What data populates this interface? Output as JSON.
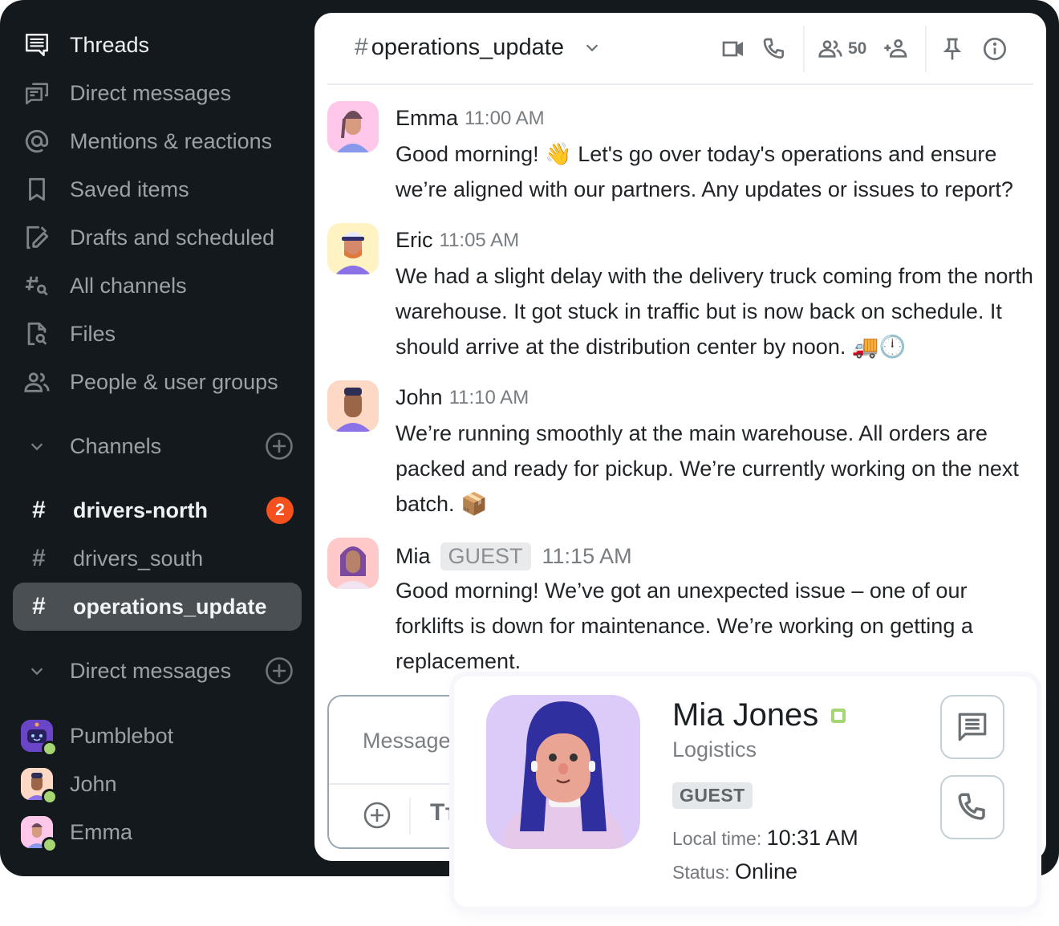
{
  "sidebar": {
    "nav": [
      {
        "label": "Threads",
        "icon": "threads-icon",
        "active": true
      },
      {
        "label": "Direct messages",
        "icon": "direct-messages-icon"
      },
      {
        "label": "Mentions & reactions",
        "icon": "at-sign-icon"
      },
      {
        "label": "Saved items",
        "icon": "bookmark-icon"
      },
      {
        "label": "Drafts and scheduled",
        "icon": "draft-edit-icon"
      },
      {
        "label": "All channels",
        "icon": "channel-search-icon"
      },
      {
        "label": "Files",
        "icon": "file-search-icon"
      },
      {
        "label": "People & user groups",
        "icon": "people-icon"
      }
    ],
    "channels_section": {
      "label": "Channels"
    },
    "channels": [
      {
        "name": "drivers-north",
        "unread": 2
      },
      {
        "name": "drivers_south"
      },
      {
        "name": "operations_update",
        "selected": true
      }
    ],
    "dm_section": {
      "label": "Direct messages"
    },
    "dms": [
      {
        "name": "Pumblebot",
        "status": "online"
      },
      {
        "name": "John",
        "status": "online"
      },
      {
        "name": "Emma",
        "status": "online"
      }
    ]
  },
  "header": {
    "hash": "#",
    "channel_name": "operations_update",
    "member_count": "50"
  },
  "messages": [
    {
      "author": "Emma",
      "time": "11:00 AM",
      "text": "Good morning! 👋 Let's go over today's operations and ensure we’re aligned with our partners. Any updates or issues to report?"
    },
    {
      "author": "Eric",
      "time": "11:05 AM",
      "text": "We had a slight delay with the delivery truck coming from the north warehouse. It got stuck in traffic but is now back on schedule. It should arrive at the distribution center by noon. 🚚🕛"
    },
    {
      "author": "John",
      "time": "11:10 AM",
      "text": "We’re running smoothly at the main warehouse. All orders are packed and ready for pickup. We’re currently working on the next batch. 📦"
    },
    {
      "author": "Mia",
      "tag": "GUEST",
      "time": "11:15 AM",
      "text": "Good morning! We’ve got an unexpected issue – one of our forklifts is down for maintenance. We’re working on getting a replacement."
    }
  ],
  "composer": {
    "placeholder": "Message",
    "format_label": "Tт"
  },
  "profile_card": {
    "name": "Mia Jones",
    "department": "Logistics",
    "tag": "GUEST",
    "local_time_label": "Local time:",
    "local_time": "10:31 AM",
    "status_label": "Status:",
    "status": "Online"
  },
  "colors": {
    "sidebar_bg": "#13191c",
    "badge": "#f4511e",
    "online": "#a6d673",
    "selected_channel_bg": "#4a4f53"
  }
}
